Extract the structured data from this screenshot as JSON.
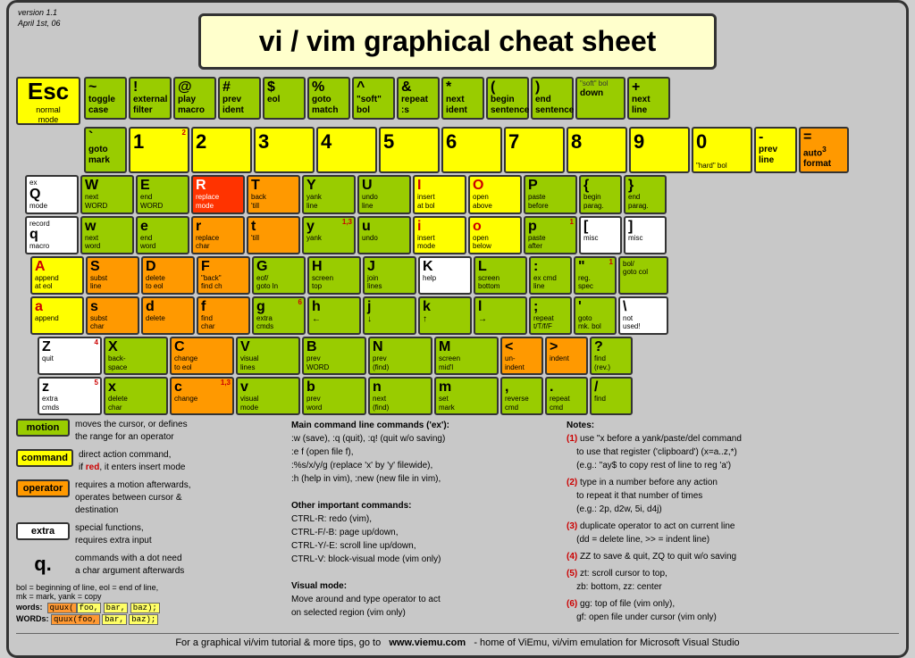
{
  "meta": {
    "version": "version 1.1",
    "date": "April 1st, 06"
  },
  "title": "vi / vim graphical cheat sheet",
  "esc": {
    "label": "Esc",
    "sublabel": "normal\nmode"
  },
  "footer": {
    "text": "For a graphical vi/vim tutorial & more tips, go to",
    "url": "www.viemu.com",
    "suffix": "- home of ViEmu, vi/vim emulation for Microsoft Visual Studio"
  }
}
